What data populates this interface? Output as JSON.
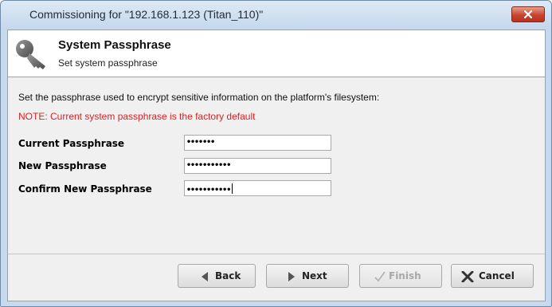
{
  "window": {
    "title": "Commissioning for \"192.168.1.123 (Titan_110)\""
  },
  "header": {
    "title": "System Passphrase",
    "subtitle": "Set system passphrase",
    "icon": "key-icon"
  },
  "content": {
    "description": "Set the passphrase used to encrypt sensitive information on the platform's filesystem:",
    "note": "NOTE: Current system passphrase is the factory default",
    "note_color": "#e02020"
  },
  "form": {
    "fields": [
      {
        "label": "Current Passphrase",
        "value": "•••••••"
      },
      {
        "label": "New Passphrase",
        "value": "•••••••••••"
      },
      {
        "label": "Confirm New Passphrase",
        "value": "•••••••••••"
      }
    ]
  },
  "buttons": {
    "back": {
      "label": "Back",
      "icon": "triangle-left-icon"
    },
    "next": {
      "label": "Next",
      "icon": "triangle-right-icon"
    },
    "finish": {
      "label": "Finish",
      "icon": "checkmark-icon",
      "enabled": false
    },
    "cancel": {
      "label": "Cancel",
      "icon": "x-icon"
    }
  }
}
